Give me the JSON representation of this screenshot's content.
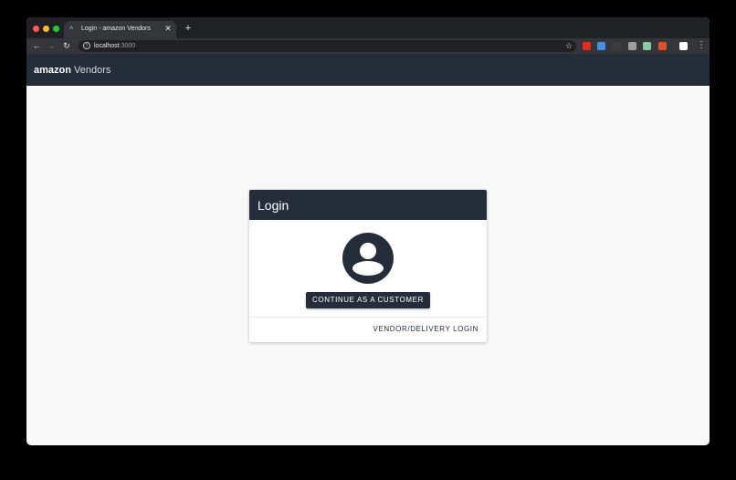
{
  "browser": {
    "tab": {
      "title": "Login - amazon Vendors",
      "close_glyph": "✕"
    },
    "new_tab_glyph": "+",
    "nav": {
      "back_glyph": "←",
      "forward_glyph": "→",
      "reload_glyph": "↻"
    },
    "address": {
      "host": "localhost",
      "port": ":3000"
    },
    "star_glyph": "☆",
    "menu_glyph": "⋮",
    "extension_colors": [
      "#d93025",
      "#4a90d9",
      "#3c3c3c",
      "#9e9e9e",
      "#8ec8a4",
      "#e0502a",
      "#ffffff"
    ]
  },
  "app": {
    "brand_bold": "amazon",
    "brand_light": "Vendors",
    "colors": {
      "header": "#262d3a",
      "background": "#f8f8f8"
    }
  },
  "login": {
    "title": "Login",
    "avatar_icon": "account-circle-icon",
    "customer_button": "CONTINUE AS A CUSTOMER",
    "vendor_link": "VENDOR/DELIVERY LOGIN"
  }
}
